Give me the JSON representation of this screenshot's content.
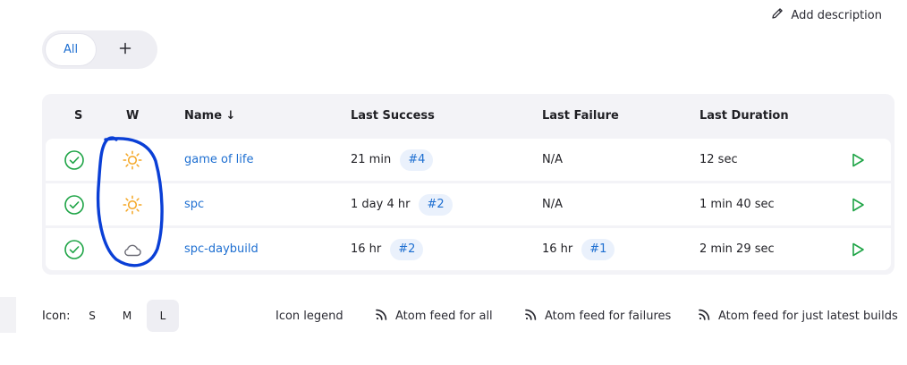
{
  "header": {
    "add_description_label": "Add description"
  },
  "view_tabs": {
    "active_label": "All",
    "add_label": "+"
  },
  "table": {
    "columns": {
      "status": "S",
      "weather": "W",
      "name": "Name ↓",
      "last_success": "Last Success",
      "last_failure": "Last Failure",
      "last_duration": "Last Duration"
    },
    "rows": [
      {
        "status_icon": "success-check-icon",
        "weather_icon": "sunny-icon",
        "name": "game of life",
        "last_success_time": "21 min",
        "last_success_build": "#4",
        "last_failure_time": "N/A",
        "last_failure_build": "",
        "last_duration": "12 sec"
      },
      {
        "status_icon": "success-check-icon",
        "weather_icon": "sunny-icon",
        "name": "spc",
        "last_success_time": "1 day 4 hr",
        "last_success_build": "#2",
        "last_failure_time": "N/A",
        "last_failure_build": "",
        "last_duration": "1 min 40 sec"
      },
      {
        "status_icon": "success-check-icon",
        "weather_icon": "cloudy-icon",
        "name": "spc-daybuild",
        "last_success_time": "16 hr",
        "last_success_build": "#2",
        "last_failure_time": "16 hr",
        "last_failure_build": "#1",
        "last_duration": "2 min 29 sec"
      }
    ]
  },
  "footer": {
    "icon_label": "Icon:",
    "sizes": [
      "S",
      "M",
      "L"
    ],
    "active_size": "L",
    "icon_legend": "Icon legend",
    "feed_all": "Atom feed for all",
    "feed_failures": "Atom feed for failures",
    "feed_latest": "Atom feed for just latest builds"
  },
  "colors": {
    "link": "#1e6fd1",
    "success": "#1ea446",
    "sun": "#f4a623",
    "cloud": "#6b6b75",
    "annotation": "#0a3fd6"
  }
}
